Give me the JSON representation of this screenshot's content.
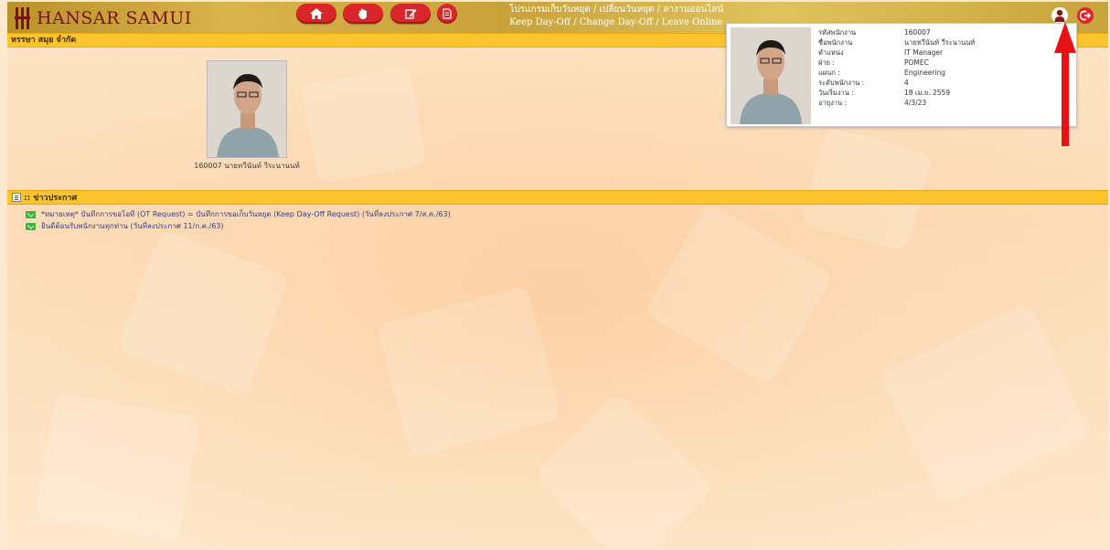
{
  "header": {
    "logo_text": "HANSAR SAMUI",
    "title_th": "โปรแกรมเก็บวันหยุด / เปลี่ยนวันหยุด / ลางานออนไลน์",
    "title_en": "Keep Day-Off / Change Day-Off / Leave Online",
    "nav": [
      {
        "icon": "home-icon"
      },
      {
        "icon": "hand-icon"
      },
      {
        "icon": "edit-icon"
      },
      {
        "icon": "document-icon"
      }
    ],
    "user_icon": "user-icon",
    "logout_icon": "logout-icon"
  },
  "company": {
    "name": "หรรษา สมุย จำกัด"
  },
  "employee_card": {
    "caption": "160007 นายทวีนันท์ วีระนานนท์"
  },
  "news": {
    "heading": ":: ข่าวประกาศ",
    "items": [
      "*หมายเหตุ* บันทึกการขอโอที (OT Request) = บันทึกการขอเก็บวันหยุด (Keep Day-Off Request) (วันที่ลงประกาศ 7/ส.ค./63)",
      "ยินดีต้อนรับพนักงานทุกท่าน (วันที่ลงประกาศ 11/ก.ค./63)"
    ]
  },
  "profile_popup": {
    "rows": [
      {
        "label": "รหัสพนักงาน",
        "value": "160007"
      },
      {
        "label": "ชื่อพนักงาน",
        "value": "นายทวีนันท์ วีระนานนท์"
      },
      {
        "label": "ตำแหน่ง",
        "value": "IT Manager"
      },
      {
        "label": "ฝ่าย :",
        "value": "POMEC"
      },
      {
        "label": "แผนก :",
        "value": "Engineering"
      },
      {
        "label": "ระดับพนักงาน :",
        "value": "4"
      },
      {
        "label": "วันเริ่มงาน :",
        "value": "18 เม.ย. 2559"
      },
      {
        "label": "อายุงาน :",
        "value": "4/3/23"
      }
    ]
  },
  "colors": {
    "header_gold": "#c9a33c",
    "logo_red": "#7a1212",
    "nav_red": "#d8262a",
    "bar_yellow": "#fcc42d",
    "link_blue": "#2f3f8a",
    "mail_green": "#3fb23a",
    "arrow_red": "#e81212"
  }
}
